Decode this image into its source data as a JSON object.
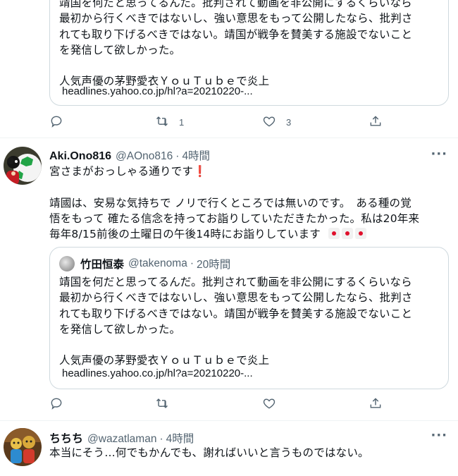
{
  "tweet0": {
    "quote": {
      "text_lines": [
        "靖国を何だと思ってるんだ。批判されて動画を非公開にするくらいなら",
        "最初から行くべきではないし、強い意思をもって公開したなら、批判さ",
        "れても取り下げるべきではない。靖国が戦争を賛美する施設でないこと",
        "を発信して欲しかった。"
      ],
      "headline": "人気声優の茅野愛衣ＹｏｕＴｕｂｅで炎上",
      "link": "headlines.yahoo.co.jp/hl?a=20210220-..."
    },
    "actions": {
      "reply": "",
      "retweet": "1",
      "like": "3"
    }
  },
  "tweet1": {
    "name": "Aki.Ono816",
    "handle": "@AOno816",
    "time": "4時間",
    "more": "···",
    "line1": "宮さまがおっしゃる通りです",
    "line1_emoji": "❗",
    "body_lines": [
      "靖國は、安易な気持ちで ノリで行くところでは無いのです。　ある種の覚",
      "悟をもって 確たる信念を持ってお詣りしていただきたかった。私は20年来",
      "毎年8/15前後の土曜日の午後14時にお詣りしています"
    ],
    "quote": {
      "name": "竹田恒泰",
      "handle": "@takenoma",
      "time": "20時間",
      "text_lines": [
        "靖国を何だと思ってるんだ。批判されて動画を非公開にするくらいなら",
        "最初から行くべきではないし、強い意思をもって公開したなら、批判さ",
        "れても取り下げるべきではない。靖国が戦争を賛美する施設でないこと",
        "を発信して欲しかった。"
      ],
      "headline": "人気声優の茅野愛衣ＹｏｕＴｕｂｅで炎上",
      "link": "headlines.yahoo.co.jp/hl?a=20210220-..."
    },
    "actions": {
      "reply": "",
      "retweet": "",
      "like": ""
    }
  },
  "tweet2": {
    "name": "ちちち",
    "handle": "@wazatlaman",
    "time": "4時間",
    "more": "···",
    "text": "本当にそう…何でもかんでも、謝ればいいと言うものではない。"
  },
  "icons": [
    "reply-icon",
    "retweet-icon",
    "like-icon",
    "share-icon",
    "more-icon"
  ],
  "colors": {
    "text": "#0f1419",
    "secondary": "#536471",
    "border": "#cfd9de",
    "divider": "#eff3f4",
    "flag_red": "#e0102c"
  }
}
